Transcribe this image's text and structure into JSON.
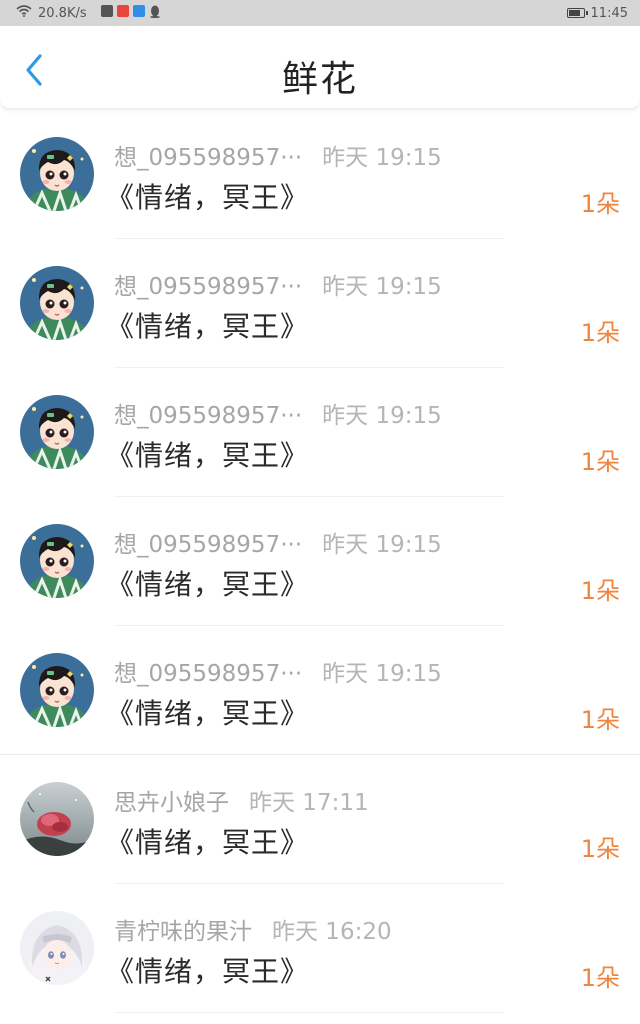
{
  "status_bar": {
    "network_speed": "20.8K/s",
    "time": "11:45",
    "battery_level": 0.85
  },
  "header": {
    "title": "鲜花"
  },
  "items": [
    {
      "name": "想_095598957···",
      "time": "昨天 19:15",
      "gift": "《情绪，冥王》",
      "count": "1朵",
      "avatar": "boy-illustration"
    },
    {
      "name": "想_095598957···",
      "time": "昨天 19:15",
      "gift": "《情绪，冥王》",
      "count": "1朵",
      "avatar": "boy-illustration"
    },
    {
      "name": "想_095598957···",
      "time": "昨天 19:15",
      "gift": "《情绪，冥王》",
      "count": "1朵",
      "avatar": "boy-illustration"
    },
    {
      "name": "想_095598957···",
      "time": "昨天 19:15",
      "gift": "《情绪，冥王》",
      "count": "1朵",
      "avatar": "boy-illustration"
    },
    {
      "name": "想_095598957···",
      "time": "昨天 19:15",
      "gift": "《情绪，冥王》",
      "count": "1朵",
      "avatar": "boy-illustration"
    },
    {
      "name": "思卉小娘子",
      "time": "昨天 17:11",
      "gift": "《情绪，冥王》",
      "count": "1朵",
      "avatar": "red-flower-photo"
    },
    {
      "name": "青柠味的果汁",
      "time": "昨天 16:20",
      "gift": "《情绪，冥王》",
      "count": "1朵",
      "avatar": "anime-girl-illustration"
    }
  ],
  "colors": {
    "accent": "#2b9be8",
    "count": "#f0863e",
    "title": "#222222",
    "meta": "#a9a9a9"
  }
}
